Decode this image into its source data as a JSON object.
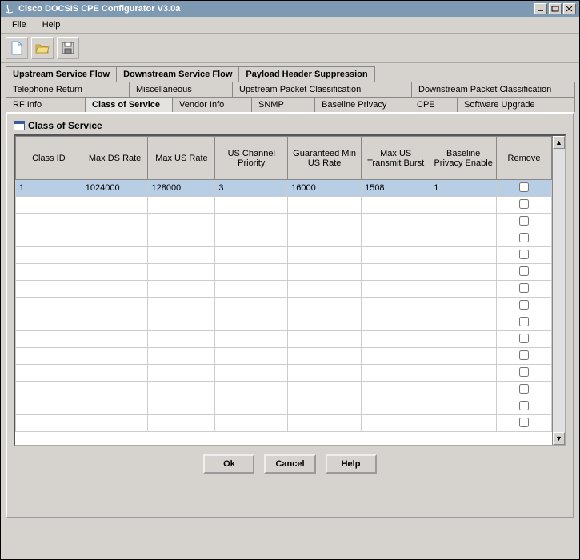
{
  "window": {
    "title": "Cisco DOCSIS CPE Configurator V3.0a"
  },
  "menu": {
    "file": "File",
    "help": "Help"
  },
  "tabs_row1": {
    "upstream_sf": "Upstream Service Flow",
    "downstream_sf": "Downstream Service Flow",
    "phs": "Payload Header Suppression"
  },
  "tabs_row2": {
    "telephone_return": "Telephone Return",
    "misc": "Miscellaneous",
    "upstream_pkt": "Upstream Packet Classification",
    "downstream_pkt": "Downstream Packet Classification"
  },
  "tabs_row3": {
    "rf_info": "RF Info",
    "class_of_service": "Class of Service",
    "vendor_info": "Vendor Info",
    "snmp": "SNMP",
    "baseline_privacy": "Baseline Privacy",
    "cpe": "CPE",
    "software_upgrade": "Software Upgrade"
  },
  "panel": {
    "title": "Class of Service",
    "columns": {
      "class_id": "Class ID",
      "max_ds_rate": "Max DS Rate",
      "max_us_rate": "Max US Rate",
      "us_channel_priority": "US Channel Priority",
      "guaranteed_min_us_rate": "Guaranteed Min US Rate",
      "max_us_transmit_burst": "Max US Transmit Burst",
      "baseline_privacy_enable": "Baseline Privacy Enable",
      "remove": "Remove"
    },
    "row0": {
      "class_id": "1",
      "max_ds_rate": "1024000",
      "max_us_rate": "128000",
      "us_channel_priority": "3",
      "guaranteed_min_us_rate": "16000",
      "max_us_transmit_burst": "1508",
      "baseline_privacy_enable": "1"
    },
    "buttons": {
      "ok": "Ok",
      "cancel": "Cancel",
      "help": "Help"
    }
  }
}
